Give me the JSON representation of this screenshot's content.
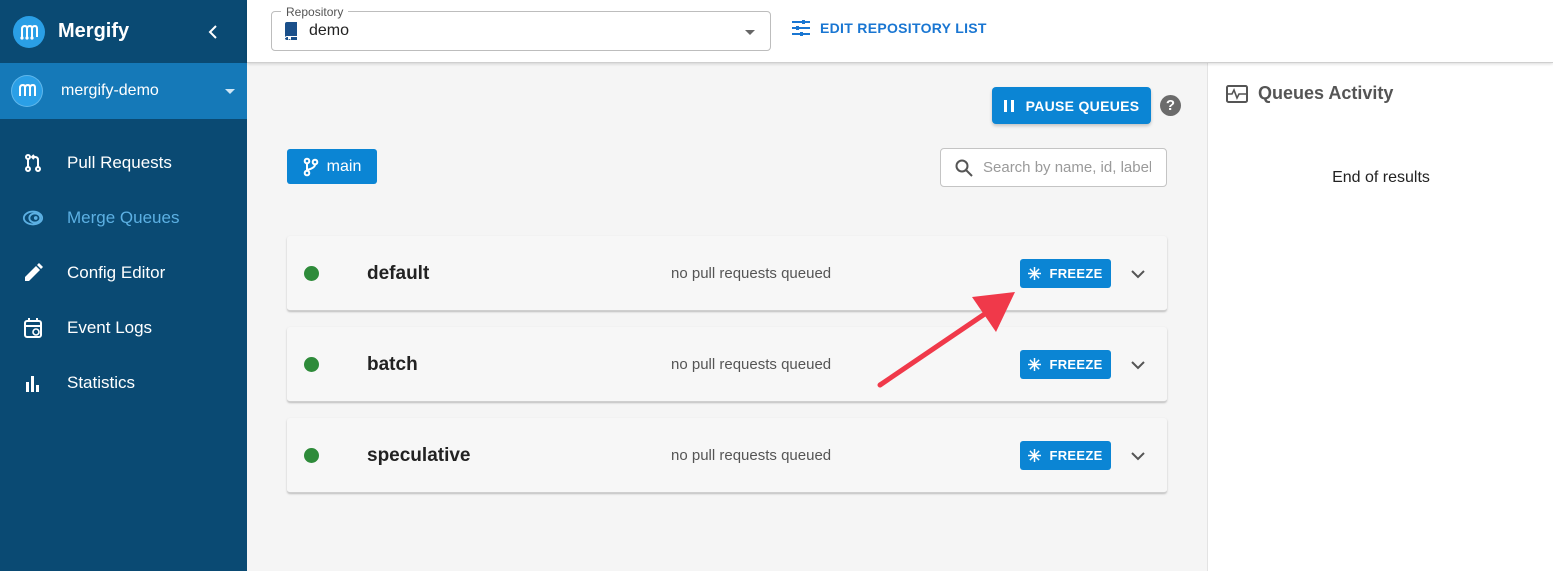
{
  "sidebar": {
    "app_name": "Mergify",
    "org_name": "mergify-demo",
    "items": [
      {
        "label": "Pull Requests",
        "icon": "pull-request-icon"
      },
      {
        "label": "Merge Queues",
        "icon": "merge-queue-icon",
        "active": true
      },
      {
        "label": "Config Editor",
        "icon": "pencil-icon"
      },
      {
        "label": "Event Logs",
        "icon": "calendar-history-icon"
      },
      {
        "label": "Statistics",
        "icon": "bar-chart-icon"
      }
    ]
  },
  "topbar": {
    "repo_label": "Repository",
    "repo_value": "demo",
    "edit_repo_label": "EDIT REPOSITORY LIST"
  },
  "main": {
    "pause_label": "PAUSE QUEUES",
    "help_glyph": "?",
    "branch_label": "main",
    "search_placeholder": "Search by name, id, label",
    "queues": [
      {
        "name": "default",
        "status": "no pull requests queued",
        "freeze_label": "FREEZE"
      },
      {
        "name": "batch",
        "status": "no pull requests queued",
        "freeze_label": "FREEZE"
      },
      {
        "name": "speculative",
        "status": "no pull requests queued",
        "freeze_label": "FREEZE"
      }
    ]
  },
  "activity": {
    "title": "Queues Activity",
    "end_text": "End of results"
  },
  "colors": {
    "sidebar_bg": "#0a4a73",
    "org_row_bg": "#1579b8",
    "primary": "#0b85d4",
    "active_nav": "#5cb0e3",
    "status_ok": "#2e8b3a",
    "annotation_arrow": "#f0394a"
  }
}
